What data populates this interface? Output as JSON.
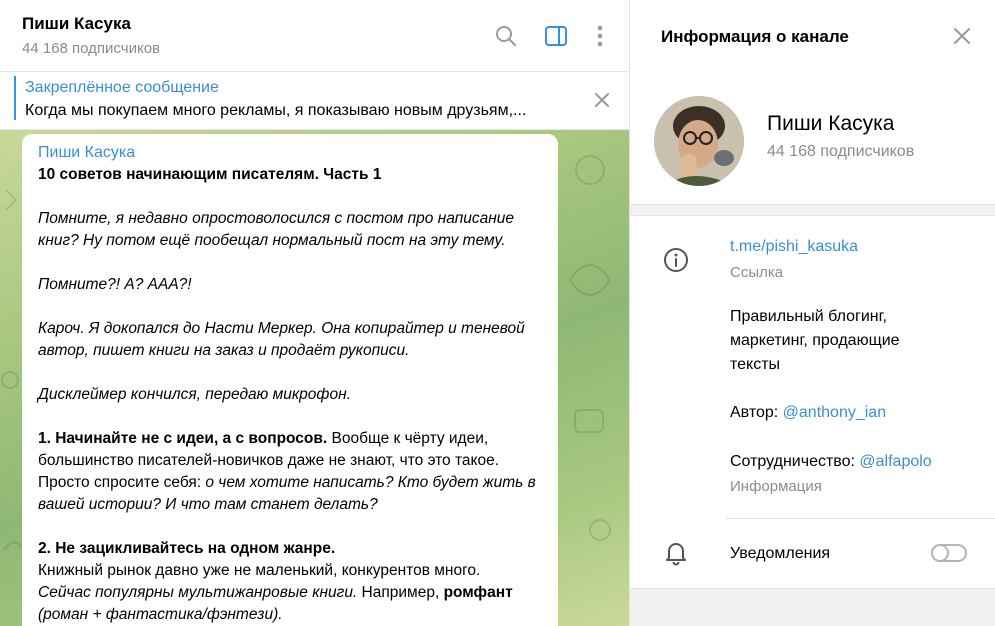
{
  "chat": {
    "title": "Пиши Касука",
    "subscribers": "44 168 подписчиков",
    "icons": [
      "search-icon",
      "sidebar-toggle-icon",
      "more-vertical-icon"
    ]
  },
  "pinned": {
    "title": "Закреплённое сообщение",
    "text": "Когда мы покупаем много рекламы, я показываю новым друзьям,..."
  },
  "message": {
    "author": "Пиши Касука",
    "title": "10 советов начинающим писателям. Часть 1",
    "p1": "Помните, я недавно опростоволосился с постом про написание книг? Ну потом ещё пообещал нормальный пост на эту тему.",
    "p2": "Помните?! А? ААА?!",
    "p3": "Кароч. Я докопался до Насти Меркер. Она копирайтер и теневой автор, пишет книги на заказ и продаёт рукописи.",
    "p4": "Дисклеймер кончился, передаю микрофон.",
    "tip1_head": "1. Начинайте не с идеи, а с вопросов.",
    "tip1_text": " Вообще к чёрту идеи, большинство писателей-новичков даже не знают, что это такое. Просто спросите себя: ",
    "tip1_italic": "о чем хотите написать? Кто будет жить в вашей истории? И что там станет делать?",
    "tip2_head": "2. Не зацикливайтесь на одном жанре.",
    "tip2_text": "Книжный рынок давно уже не маленький, конкурентов много.",
    "tip2_italic": "Сейчас популярны мультижанровые книги.",
    "tip2_text2": " Например, ",
    "tip2_bold": "ромфант",
    "tip2_italic2": "(роман + фантастика/фэнтези)."
  },
  "info": {
    "title": "Информация о канале",
    "channel_name": "Пиши Касука",
    "subscribers": "44 168 подписчиков",
    "link": "t.me/pishi_kasuka",
    "link_label": "Ссылка",
    "desc1": "Правильный блогинг, маркетинг, продающие тексты",
    "author_prefix": "Автор: ",
    "author_mention": "@anthony_ian",
    "coop_prefix": "Сотрудничество: ",
    "coop_mention": "@alfapolo",
    "desc_label": "Информация",
    "notifications_label": "Уведомления",
    "notifications_on": false
  },
  "colors": {
    "accent": "#3390ec",
    "link": "#3a8fd4",
    "muted": "#8b8b8b"
  }
}
